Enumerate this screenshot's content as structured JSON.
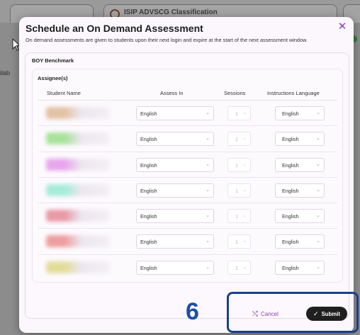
{
  "background": {
    "tab_title": "ISIP ADVSCG Classification",
    "left_label": "ilab"
  },
  "modal": {
    "title": "Schedule an On Demand Assessment",
    "subtitle": "On demand assessments are given to students upon their next login and expire at the start of the next assessment window.",
    "close_icon": "close-icon",
    "section_title": "BOY Benchmark",
    "assignee_title": "Assignee(s)",
    "columns": [
      "Student Name",
      "Assess In",
      "Sessions",
      "Instructions Language"
    ],
    "rows": [
      {
        "name_color": "#e3c2a4",
        "assess_in": "English",
        "sessions": "1",
        "language": "English"
      },
      {
        "name_color": "#a9e29a",
        "assess_in": "English",
        "sessions": "1",
        "language": "English"
      },
      {
        "name_color": "#e8a6ec",
        "assess_in": "English",
        "sessions": "1",
        "language": "English"
      },
      {
        "name_color": "#a7ecd9",
        "assess_in": "English",
        "sessions": "1",
        "language": "English"
      },
      {
        "name_color": "#e79aa8",
        "assess_in": "English",
        "sessions": "1",
        "language": "English"
      },
      {
        "name_color": "#ee9e9e",
        "assess_in": "English",
        "sessions": "1",
        "language": "English"
      },
      {
        "name_color": "#e2dc9a",
        "assess_in": "English",
        "sessions": "1",
        "language": "English"
      }
    ]
  },
  "footer": {
    "cancel_label": "Cancel",
    "submit_label": "Submit",
    "cancel_icon": "cancel-icon",
    "submit_icon": "check-icon"
  },
  "annotation": {
    "step_number": "6",
    "highlight_color": "#1a3f8f"
  },
  "colors": {
    "accent": "#8e3fb0",
    "submit_bg": "#1f1f1f",
    "step_number": "#1c4fa8"
  }
}
